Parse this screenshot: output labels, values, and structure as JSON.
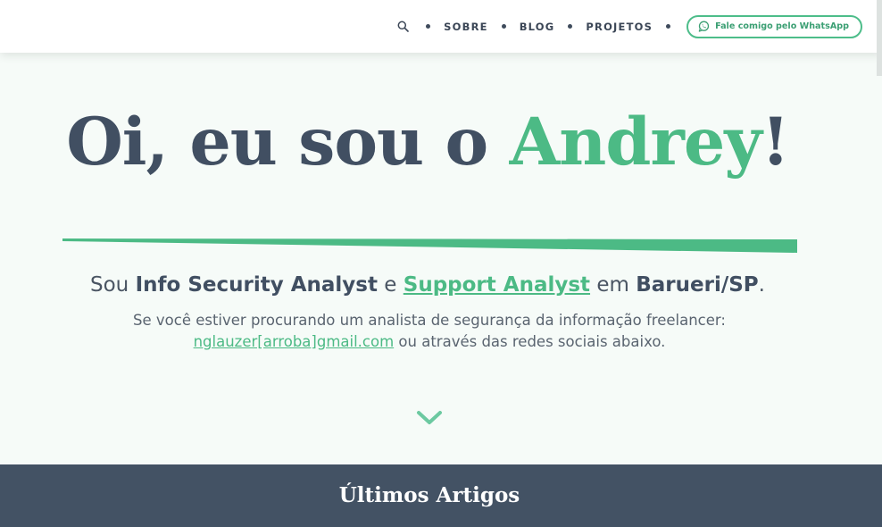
{
  "header": {
    "nav": {
      "search_icon": "search-icon",
      "items": [
        {
          "label": "SOBRE"
        },
        {
          "label": "BLOG"
        },
        {
          "label": "PROJETOS"
        }
      ],
      "whatsapp_button": {
        "label": "Fale comigo pelo WhatsApp",
        "icon": "whatsapp-icon"
      }
    }
  },
  "hero": {
    "headline_prefix": "Oi, eu sou o ",
    "headline_name": "Andrey",
    "headline_suffix": "!",
    "subtitle": {
      "part1": "Sou ",
      "role1": "Info Security Analyst",
      "part2": " e ",
      "role2": "Support Analyst",
      "part3": " em ",
      "location": "Barueri/SP",
      "part4": "."
    },
    "description_line1": "Se você estiver procurando um analista de segurança da informação freelancer:",
    "email_link": "nglauzer[arroba]gmail.com",
    "description_line2_suffix": " ou através das redes sociais abaixo.",
    "scroll_icon": "chevron-down-icon"
  },
  "latest": {
    "title": "Últimos Artigos"
  },
  "colors": {
    "accent": "#4cba85",
    "dark": "#414f62",
    "band": "#435264",
    "background": "#f6fbf8"
  }
}
